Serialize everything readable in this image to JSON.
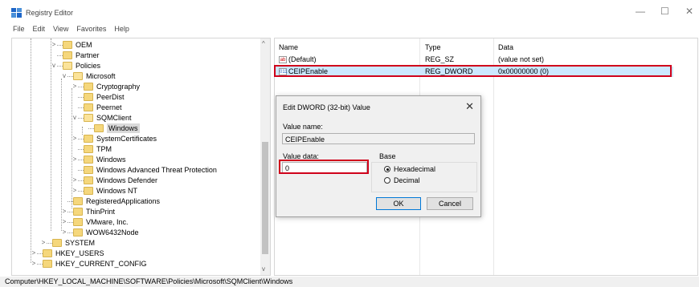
{
  "window": {
    "title": "Registry Editor",
    "minimize": "—",
    "maximize": "☐",
    "close": "✕"
  },
  "menu": [
    "File",
    "Edit",
    "View",
    "Favorites",
    "Help"
  ],
  "tree": {
    "items": [
      {
        "label": "OEM",
        "expander": ">"
      },
      {
        "label": "Partner",
        "expander": ""
      },
      {
        "label": "Policies",
        "expander": "v"
      },
      {
        "label": "Microsoft",
        "expander": "v"
      },
      {
        "label": "Cryptography",
        "expander": ">"
      },
      {
        "label": "PeerDist",
        "expander": ""
      },
      {
        "label": "Peernet",
        "expander": ""
      },
      {
        "label": "SQMClient",
        "expander": "v"
      },
      {
        "label": "Windows",
        "expander": ""
      },
      {
        "label": "SystemCertificates",
        "expander": ">"
      },
      {
        "label": "TPM",
        "expander": ""
      },
      {
        "label": "Windows",
        "expander": ">"
      },
      {
        "label": "Windows Advanced Threat Protection",
        "expander": ""
      },
      {
        "label": "Windows Defender",
        "expander": ">"
      },
      {
        "label": "Windows NT",
        "expander": ">"
      },
      {
        "label": "RegisteredApplications",
        "expander": ""
      },
      {
        "label": "ThinPrint",
        "expander": ">"
      },
      {
        "label": "VMware, Inc.",
        "expander": ">"
      },
      {
        "label": "WOW6432Node",
        "expander": ">"
      },
      {
        "label": "SYSTEM",
        "expander": ">"
      },
      {
        "label": "HKEY_USERS",
        "expander": ">"
      },
      {
        "label": "HKEY_CURRENT_CONFIG",
        "expander": ">"
      }
    ]
  },
  "list": {
    "columns": {
      "name": "Name",
      "type": "Type",
      "data": "Data"
    },
    "rows": [
      {
        "icon": "ab",
        "name": "(Default)",
        "type": "REG_SZ",
        "data": "(value not set)"
      },
      {
        "icon": "011",
        "name": "CEIPEnable",
        "type": "REG_DWORD",
        "data": "0x00000000 (0)"
      }
    ]
  },
  "dialog": {
    "title": "Edit DWORD (32-bit) Value",
    "close": "✕",
    "value_name_label": "Value name:",
    "value_name": "CEIPEnable",
    "value_data_label": "Value data:",
    "value_data": "0",
    "base_label": "Base",
    "hex_label": "Hexadecimal",
    "dec_label": "Decimal",
    "base_selected": "Hexadecimal",
    "ok": "OK",
    "cancel": "Cancel"
  },
  "status": {
    "path": "Computer\\HKEY_LOCAL_MACHINE\\SOFTWARE\\Policies\\Microsoft\\SQMClient\\Windows"
  },
  "colors": {
    "selection": "#cce8ff",
    "highlight": "#d0021b",
    "folder": "#f5d77c",
    "accent": "#0078d7"
  }
}
